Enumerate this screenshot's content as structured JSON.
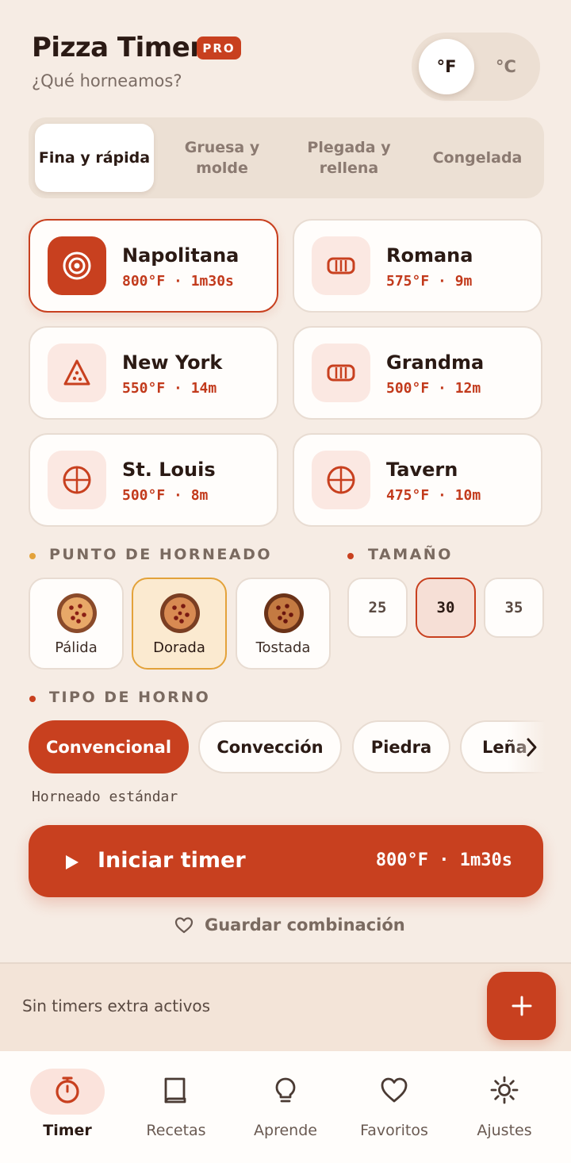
{
  "header": {
    "title": "Pizza Timer",
    "badge": "PRO",
    "subtitle": "¿Qué horneamos?"
  },
  "units": {
    "options": [
      "°F",
      "°C"
    ],
    "selected": "°F"
  },
  "categories": {
    "tabs": [
      {
        "label": "Fina y rápida",
        "active": true
      },
      {
        "label": "Gruesa y molde",
        "active": false
      },
      {
        "label": "Plegada y rellena",
        "active": false
      },
      {
        "label": "Congelada",
        "active": false
      }
    ]
  },
  "pizzas": [
    {
      "name": "Napolitana",
      "temp": "800°F",
      "time": "1m30s",
      "icon": "target-icon",
      "selected": true
    },
    {
      "name": "Romana",
      "temp": "575°F",
      "time": "9m",
      "icon": "rectangle-slab-icon",
      "selected": false
    },
    {
      "name": "New York",
      "temp": "550°F",
      "time": "14m",
      "icon": "pizza-slice-icon",
      "selected": false
    },
    {
      "name": "Grandma",
      "temp": "500°F",
      "time": "12m",
      "icon": "rectangle-slab-icon",
      "selected": false
    },
    {
      "name": "St. Louis",
      "temp": "500°F",
      "time": "8m",
      "icon": "cut-circle-icon",
      "selected": false
    },
    {
      "name": "Tavern",
      "temp": "475°F",
      "time": "10m",
      "icon": "cut-circle-icon",
      "selected": false
    }
  ],
  "doneness": {
    "label": "PUNTO DE HORNEADO",
    "options": [
      {
        "label": "Pálida",
        "selected": false,
        "color": "#d9935a"
      },
      {
        "label": "Dorada",
        "selected": true,
        "color": "#c87a45"
      },
      {
        "label": "Tostada",
        "selected": false,
        "color": "#a8602f"
      }
    ]
  },
  "size": {
    "label": "TAMAÑO",
    "options": [
      "25",
      "30",
      "35"
    ],
    "selected": "30"
  },
  "oven": {
    "label": "TIPO DE HORNO",
    "options": [
      "Convencional",
      "Convección",
      "Piedra",
      "Leña"
    ],
    "selected": "Convencional",
    "description": "Horneado estándar"
  },
  "start": {
    "label": "Iniciar timer",
    "meta": "800°F · 1m30s"
  },
  "save": {
    "label": "Guardar combinación"
  },
  "extra": {
    "text": "Sin timers extra activos"
  },
  "nav": [
    {
      "label": "Timer",
      "icon": "stopwatch-icon",
      "active": true
    },
    {
      "label": "Recetas",
      "icon": "book-icon",
      "active": false
    },
    {
      "label": "Aprende",
      "icon": "lightbulb-icon",
      "active": false
    },
    {
      "label": "Favoritos",
      "icon": "heart-icon",
      "active": false
    },
    {
      "label": "Ajustes",
      "icon": "sun-icon",
      "active": false
    }
  ],
  "colors": {
    "accent": "#c8401f",
    "background": "#f6ece4",
    "doneness_highlight": "#e3a23a"
  }
}
